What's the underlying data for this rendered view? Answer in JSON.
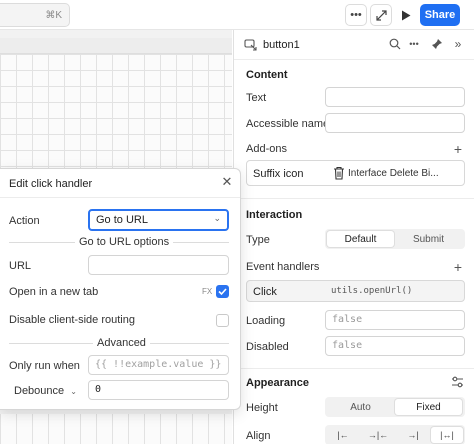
{
  "topbar": {
    "search_shortcut": "⌘K",
    "share_label": "Share",
    "icons": [
      "more-icon",
      "expand-icon",
      "play-icon"
    ]
  },
  "inspector": {
    "component_name": "button1",
    "content": {
      "title": "Content",
      "text_label": "Text",
      "text_value": "",
      "accessible_name_label": "Accessible name",
      "accessible_name_value": ""
    },
    "addons": {
      "title": "Add-ons",
      "suffix_label": "Suffix icon",
      "suffix_value": "Interface Delete Bi..."
    },
    "interaction": {
      "title": "Interaction",
      "type_label": "Type",
      "type_options": [
        "Default",
        "Submit"
      ],
      "type_selected": "Default",
      "event_handlers_label": "Event handlers",
      "handler_event": "Click",
      "handler_code": "utils.openUrl()",
      "loading_label": "Loading",
      "loading_value": "false",
      "disabled_label": "Disabled",
      "disabled_value": "false"
    },
    "appearance": {
      "title": "Appearance",
      "height_label": "Height",
      "height_options": [
        "Auto",
        "Fixed"
      ],
      "height_selected": "Fixed",
      "align_label": "Align",
      "align_options": [
        "align-left-icon",
        "align-center-icon",
        "align-right-icon",
        "align-stretch-icon"
      ],
      "align_selected": "align-stretch-icon"
    }
  },
  "popover": {
    "title": "Edit click handler",
    "action_label": "Action",
    "action_value": "Go to URL",
    "options_header": "Go to URL options",
    "url_label": "URL",
    "url_value": "",
    "new_tab_label": "Open in a new tab",
    "new_tab_checked": true,
    "fx_label": "FX",
    "disable_routing_label": "Disable client-side routing",
    "disable_routing_checked": false,
    "advanced_header": "Advanced",
    "only_run_label": "Only run when",
    "only_run_placeholder": "{{ !!example.value }}",
    "debounce_label": "Debounce",
    "debounce_value": "0"
  },
  "colors": {
    "accent": "#2a73f0",
    "share": "#1f6ff2"
  }
}
